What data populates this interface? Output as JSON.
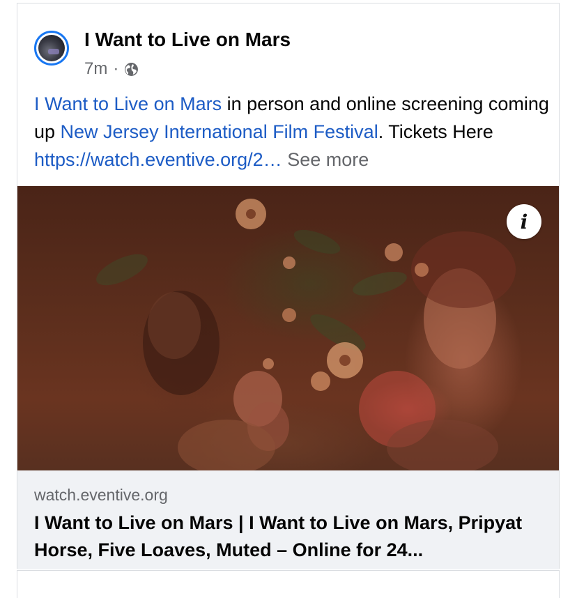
{
  "post": {
    "page_name": "I Want to Live on Mars",
    "time": "7m",
    "separator": "·",
    "privacy_icon": "globe-icon",
    "text": {
      "link_1": "I Want to Live on Mars",
      "plain_1": " in person and online screening coming up ",
      "link_2": "New Jersey International Film Festival",
      "plain_2": ". Tickets Here ",
      "link_3": "https://watch.eventive.org/2…",
      "see_more": " See more"
    },
    "image": {
      "info_button_label": "i"
    },
    "link_preview": {
      "domain": "watch.eventive.org",
      "title": "I Want to Live on Mars | I Want to Live on Mars, Pripyat Horse, Five Loaves, Muted – Online for 24..."
    }
  },
  "colors": {
    "link": "#1d5cc5",
    "secondary_text": "#65676b",
    "avatar_ring": "#1877f2",
    "preview_bg": "#f0f2f5"
  }
}
